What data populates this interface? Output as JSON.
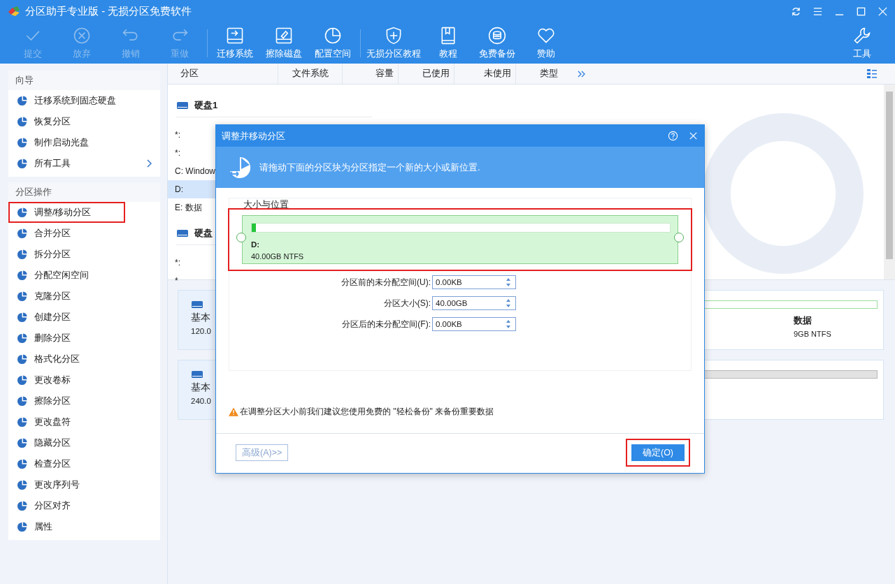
{
  "window": {
    "title": "分区助手专业版 - 无损分区免费软件"
  },
  "toolbar": [
    {
      "label": "提交",
      "disabled": true
    },
    {
      "label": "放弃",
      "disabled": true
    },
    {
      "label": "撤销",
      "disabled": true
    },
    {
      "label": "重做",
      "disabled": true
    },
    {
      "label": "迁移系统",
      "disabled": false
    },
    {
      "label": "擦除磁盘",
      "disabled": false
    },
    {
      "label": "配置空间",
      "disabled": false
    },
    {
      "label": "无损分区教程",
      "disabled": false
    },
    {
      "label": "教程",
      "disabled": false
    },
    {
      "label": "免费备份",
      "disabled": false
    },
    {
      "label": "赞助",
      "disabled": false
    },
    {
      "label": "工具",
      "disabled": false
    }
  ],
  "sidebar": {
    "sections": [
      {
        "title": "向导",
        "items": [
          {
            "label": "迁移系统到固态硬盘",
            "highlighted": false
          },
          {
            "label": "恢复分区",
            "highlighted": false
          },
          {
            "label": "制作启动光盘",
            "highlighted": false
          },
          {
            "label": "所有工具",
            "highlighted": false,
            "has_submenu": true
          }
        ]
      },
      {
        "title": "分区操作",
        "items": [
          {
            "label": "调整/移动分区",
            "highlighted": true
          },
          {
            "label": "合并分区",
            "highlighted": false
          },
          {
            "label": "拆分分区",
            "highlighted": false
          },
          {
            "label": "分配空闲空间",
            "highlighted": false
          },
          {
            "label": "克隆分区",
            "highlighted": false
          },
          {
            "label": "创建分区",
            "highlighted": false
          },
          {
            "label": "删除分区",
            "highlighted": false
          },
          {
            "label": "格式化分区",
            "highlighted": false
          },
          {
            "label": "更改卷标",
            "highlighted": false
          },
          {
            "label": "擦除分区",
            "highlighted": false
          },
          {
            "label": "更改盘符",
            "highlighted": false
          },
          {
            "label": "隐藏分区",
            "highlighted": false
          },
          {
            "label": "检查分区",
            "highlighted": false
          },
          {
            "label": "更改序列号",
            "highlighted": false
          },
          {
            "label": "分区对齐",
            "highlighted": false
          },
          {
            "label": "属性",
            "highlighted": false
          }
        ]
      }
    ]
  },
  "table": {
    "columns": [
      "分区",
      "文件系统",
      "容量",
      "已使用",
      "未使用",
      "类型"
    ]
  },
  "disks": [
    {
      "name": "硬盘1",
      "partitions": [
        {
          "label": "*:",
          "selected": false
        },
        {
          "label": "*:",
          "selected": false
        },
        {
          "label": "C: Window",
          "selected": false
        },
        {
          "label": "D:",
          "selected": true
        },
        {
          "label": "E: 数据",
          "selected": false
        }
      ]
    },
    {
      "name": "硬盘",
      "partitions": [
        {
          "label": "*:",
          "selected": false
        },
        {
          "label": "*",
          "selected": false
        }
      ]
    }
  ],
  "disk_cards": [
    {
      "type": "基本",
      "size": "120.0",
      "right_partition": {
        "kind": "ntfs",
        "label": "数据",
        "info": "9GB NTFS"
      }
    },
    {
      "type": "基本",
      "size": "240.0",
      "right_partition": {
        "kind": "unallocated"
      }
    }
  ],
  "dialog": {
    "title": "调整并移动分区",
    "banner": "请拖动下面的分区块为分区指定一个新的大小或新位置.",
    "group_title": "大小与位置",
    "partition": {
      "label": "D:",
      "info": "40.00GB NTFS",
      "level": 0.01,
      "highlighted": true
    },
    "fields": [
      {
        "label": "分区前的未分配空间(U):",
        "value": "0.00KB"
      },
      {
        "label": "分区大小(S):",
        "value": "40.00GB"
      },
      {
        "label": "分区后的未分配空间(F):",
        "value": "0.00KB"
      }
    ],
    "warning": "在调整分区大小前我们建议您使用免费的 \"轻松备份\" 来备份重要数据",
    "buttons": [
      {
        "label": "高级(A)>>",
        "kind": "secondary",
        "highlighted": false
      },
      {
        "label": "确定(O)",
        "kind": "primary",
        "highlighted": true
      }
    ]
  }
}
